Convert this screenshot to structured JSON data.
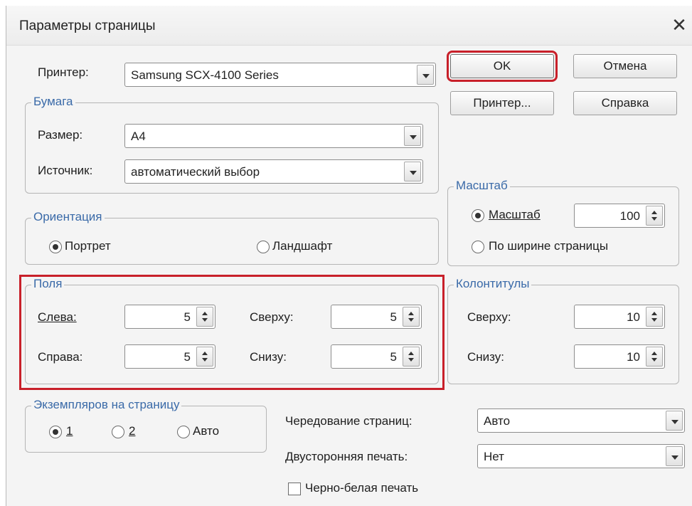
{
  "window": {
    "title": "Параметры страницы"
  },
  "printer": {
    "label": "Принтер:",
    "value": "Samsung SCX-4100 Series"
  },
  "buttons": {
    "ok": "OK",
    "cancel": "Отмена",
    "printer": "Принтер...",
    "help": "Справка"
  },
  "paper": {
    "title": "Бумага",
    "size_label": "Размер:",
    "size_value": "A4",
    "source_label": "Источник:",
    "source_value": "автоматический выбор"
  },
  "scale": {
    "title": "Масштаб",
    "scale_option": "Масштаб",
    "scale_value": "100",
    "fit_option": "По ширине страницы",
    "selected": "scale"
  },
  "orientation": {
    "title": "Ориентация",
    "portrait": "Портрет",
    "landscape": "Ландшафт",
    "selected": "portrait"
  },
  "margins": {
    "title": "Поля",
    "left_label": "Слева:",
    "left_value": "5",
    "top_label": "Сверху:",
    "top_value": "5",
    "right_label": "Справа:",
    "right_value": "5",
    "bottom_label": "Снизу:",
    "bottom_value": "5"
  },
  "headers": {
    "title": "Колонтитулы",
    "top_label": "Сверху:",
    "top_value": "10",
    "bottom_label": "Снизу:",
    "bottom_value": "10"
  },
  "copies": {
    "title": "Экземпляров на страницу",
    "opt1": "1",
    "opt2": "2",
    "auto": "Авто",
    "selected": "1"
  },
  "collate": {
    "label": "Чередование страниц:",
    "value": "Авто"
  },
  "duplex": {
    "label": "Двусторонняя печать:",
    "value": "Нет"
  },
  "bw": {
    "label": "Черно-белая печать",
    "checked": false
  },
  "colors": {
    "highlight": "#c8202a",
    "group_title": "#3a6aa8"
  },
  "icons": {
    "close": "close-icon",
    "dropdown": "chevron-down-icon",
    "spinner": "spinner-arrows-icon"
  }
}
